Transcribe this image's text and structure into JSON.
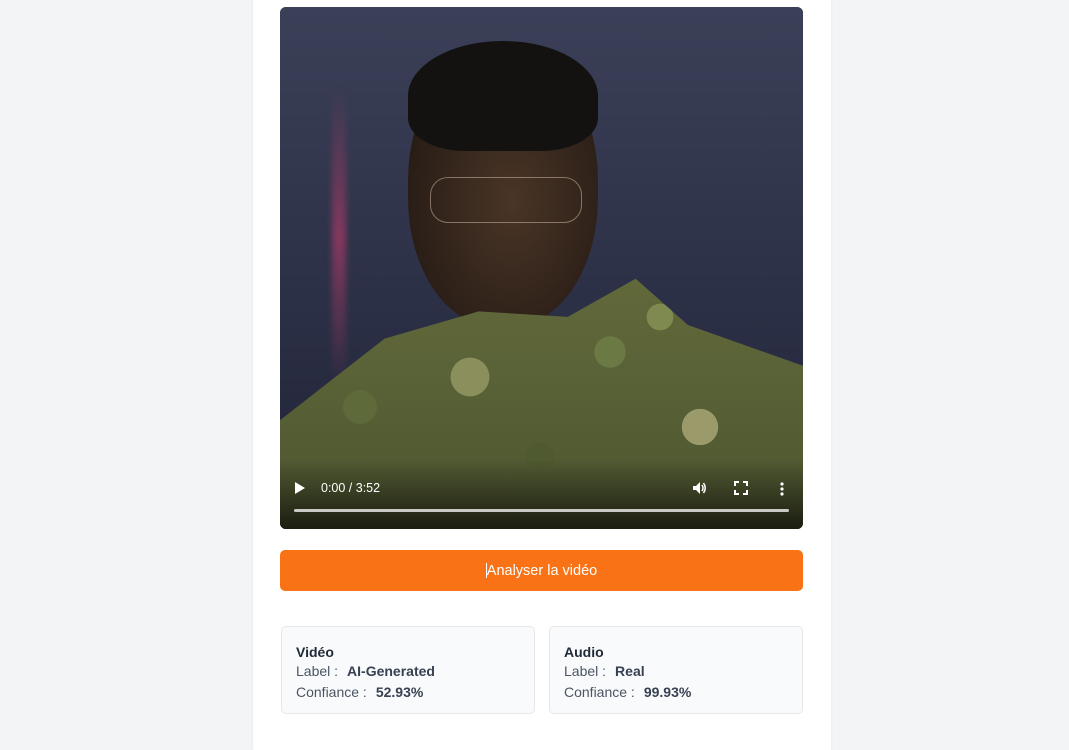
{
  "video_player": {
    "time_display": "0:00 / 3:52",
    "progress_fraction": 0,
    "play_icon": "play-icon",
    "volume_icon": "volume-icon",
    "fullscreen_icon": "fullscreen-icon",
    "more_icon": "more-vertical-icon"
  },
  "analyze_button": {
    "label": "Analyser la vidéo",
    "color": "#f97316"
  },
  "results": {
    "video": {
      "title": "Vidéo",
      "label_key": "Label :",
      "label_value": "AI-Generated",
      "confidence_key": "Confiance :",
      "confidence_value": "52.93%"
    },
    "audio": {
      "title": "Audio",
      "label_key": "Label :",
      "label_value": "Real",
      "confidence_key": "Confiance :",
      "confidence_value": "99.93%"
    }
  }
}
